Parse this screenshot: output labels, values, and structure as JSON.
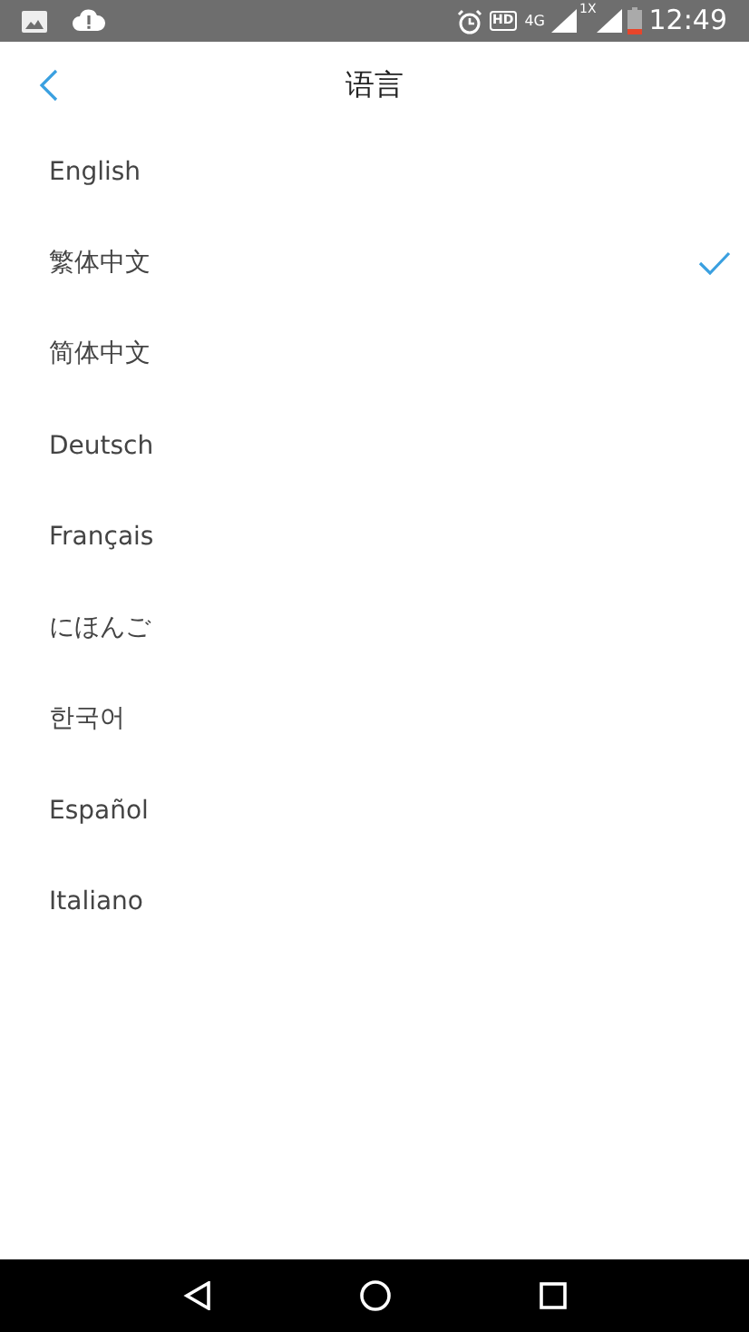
{
  "status_bar": {
    "hd": "HD",
    "network": "4G",
    "roaming": "1X",
    "time": "12:49"
  },
  "header": {
    "title": "语言"
  },
  "languages": [
    {
      "label": "English",
      "selected": false
    },
    {
      "label": "繁体中文",
      "selected": true
    },
    {
      "label": "简体中文",
      "selected": false
    },
    {
      "label": "Deutsch",
      "selected": false
    },
    {
      "label": "Français",
      "selected": false
    },
    {
      "label": "にほんご",
      "selected": false
    },
    {
      "label": "한국어",
      "selected": false
    },
    {
      "label": "Español",
      "selected": false
    },
    {
      "label": "Italiano",
      "selected": false
    }
  ]
}
